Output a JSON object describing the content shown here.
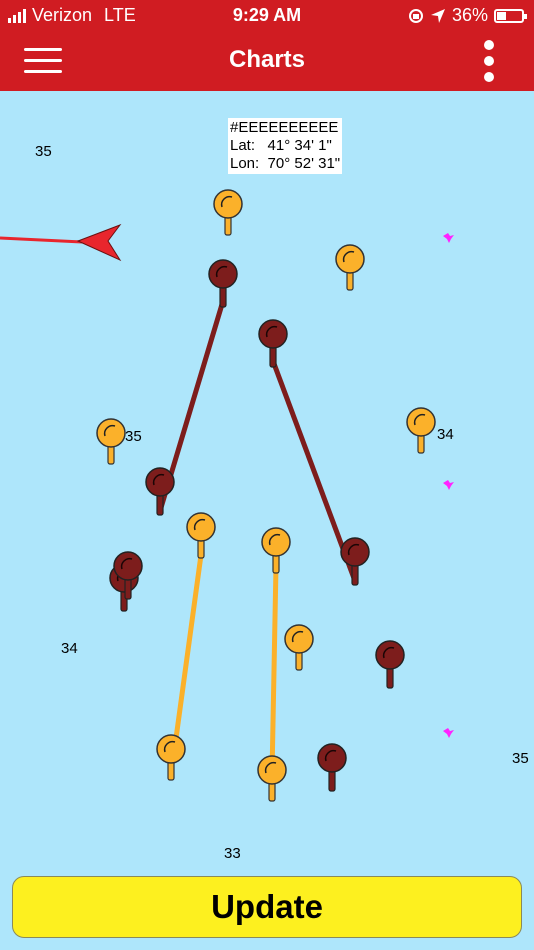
{
  "status_bar": {
    "carrier": "Verizon",
    "network": "LTE",
    "time": "9:29 AM",
    "battery_percent": "36%",
    "battery_level": 0.36
  },
  "header": {
    "title": "Charts"
  },
  "map": {
    "coord_box": {
      "id": "#EEEEEEEEEE",
      "lat_label": "Lat:",
      "lat_value": "41° 34' 1\"",
      "lon_label": "Lon:",
      "lon_value": "70° 52' 31\""
    },
    "depths": [
      "35",
      "35",
      "34",
      "34",
      "35",
      "33"
    ],
    "colors": {
      "water": "#aee6fb",
      "track": "#e8262d",
      "orange_pin": "#fbb12a",
      "red_pin": "#7d1d1c",
      "bird": "#ff22ff"
    }
  },
  "footer": {
    "update_label": "Update"
  }
}
